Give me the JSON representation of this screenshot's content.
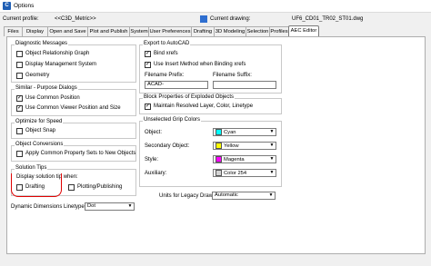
{
  "window": {
    "title": "Options"
  },
  "profile": {
    "label": "Current profile:",
    "value": "<<C3D_Metric>>",
    "drawing_label": "Current drawing:",
    "drawing_value": "UF6_CD01_TR02_ST01.dwg"
  },
  "tabs": [
    "Files",
    "Display",
    "Open and Save",
    "Plot and Publish",
    "System",
    "User Preferences",
    "Drafting",
    "3D Modeling",
    "Selection",
    "Profiles",
    "AEC Editor"
  ],
  "active_tab": "AEC Editor",
  "diagnostic": {
    "title": "Diagnostic Messages",
    "items": [
      {
        "label": "Object Relationship Graph",
        "checked": false
      },
      {
        "label": "Display Management System",
        "checked": false
      },
      {
        "label": "Geometry",
        "checked": false
      }
    ]
  },
  "similar": {
    "title": "Similar - Purpose Dialogs",
    "items": [
      {
        "label": "Use Common Position",
        "checked": true
      },
      {
        "label": "Use Common Viewer Position and Size",
        "checked": true
      }
    ]
  },
  "optimize": {
    "title": "Optimize for Speed",
    "items": [
      {
        "label": "Object Snap",
        "checked": false
      }
    ]
  },
  "conversions": {
    "title": "Object Conversions",
    "items": [
      {
        "label": "Apply Common Property Sets to New Objects",
        "checked": false
      }
    ]
  },
  "solution": {
    "title": "Solution Tips",
    "subtitle": "Display solution tip when:",
    "items": [
      {
        "label": "Drafting",
        "checked": false
      },
      {
        "label": "Plotting/Publishing",
        "checked": false
      }
    ]
  },
  "dyn_linetype": {
    "label": "Dynamic Dimensions Linetype:",
    "value": "Dot"
  },
  "export": {
    "title": "Export to AutoCAD",
    "items": [
      {
        "label": "Bind xrefs",
        "checked": true
      },
      {
        "label": "Use Insert Method when Binding xrefs",
        "checked": true
      }
    ],
    "prefix_label": "Filename Prefix:",
    "prefix_value": "ACAD-",
    "suffix_label": "Filename Suffix:",
    "suffix_value": ""
  },
  "exploded": {
    "title": "Block Properties of Exploded Objects",
    "items": [
      {
        "label": "Maintain Resolved Layer, Color, Linetype",
        "checked": true
      }
    ]
  },
  "grip": {
    "title": "Unselected Grip Colors",
    "rows": [
      {
        "label": "Object:",
        "value": "Cyan",
        "color": "#00ffff"
      },
      {
        "label": "Secondary Object:",
        "value": "Yellow",
        "color": "#ffff00"
      },
      {
        "label": "Style:",
        "value": "Magenta",
        "color": "#ff00ff"
      },
      {
        "label": "Auxiliary:",
        "value": "Color 254",
        "color": "#d4d4d4"
      }
    ]
  },
  "legacy_units": {
    "label": "Units for Legacy Drawings:",
    "value": "Automatic"
  }
}
